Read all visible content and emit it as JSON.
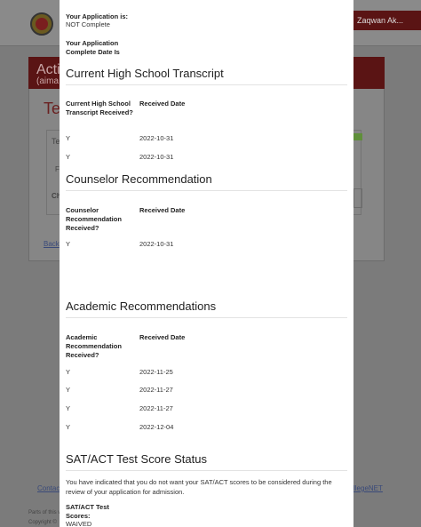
{
  "background": {
    "user_name": "Zaqwan Ak...",
    "card_title_1": "Activ",
    "card_title_2": "(aima",
    "section_label": "Te",
    "box_label": "Te",
    "row_label_1": "F",
    "row_label_2": "Ch",
    "back_link": "Back",
    "contact_link": "Contac",
    "collegenet_link": "llegeNET",
    "footer_1": "Parts of this w",
    "footer_2": "Copyright ©"
  },
  "modal": {
    "status": {
      "label": "Your Application is:",
      "value": "NOT Complete",
      "complete_label": "Your Application Complete Date Is"
    },
    "transcript": {
      "title": "Current High School Transcript",
      "col1": "Current High School Transcript Received?",
      "col2": "Received Date",
      "rows": [
        {
          "received": "Y",
          "date": "2022-10-31"
        },
        {
          "received": "Y",
          "date": "2022-10-31"
        }
      ]
    },
    "counselor": {
      "title": "Counselor Recommendation",
      "col1": "Counselor Recommendation Received?",
      "col2": "Received Date",
      "rows": [
        {
          "received": "Y",
          "date": "2022-10-31"
        }
      ]
    },
    "academic": {
      "title": "Academic Recommendations",
      "col1": "Academic Recommendation Received?",
      "col2": "Received Date",
      "rows": [
        {
          "received": "Y",
          "date": "2022-11-25"
        },
        {
          "received": "Y",
          "date": "2022-11-27"
        },
        {
          "received": "Y",
          "date": "2022-11-27"
        },
        {
          "received": "Y",
          "date": "2022-12-04"
        }
      ]
    },
    "sat": {
      "title": "SAT/ACT Test Score Status",
      "message": "You have indicated that you do not want your SAT/ACT scores to be considered during the review of your application for admission.",
      "label": "SAT/ACT Test Scores:",
      "value": "WAIVED"
    }
  }
}
